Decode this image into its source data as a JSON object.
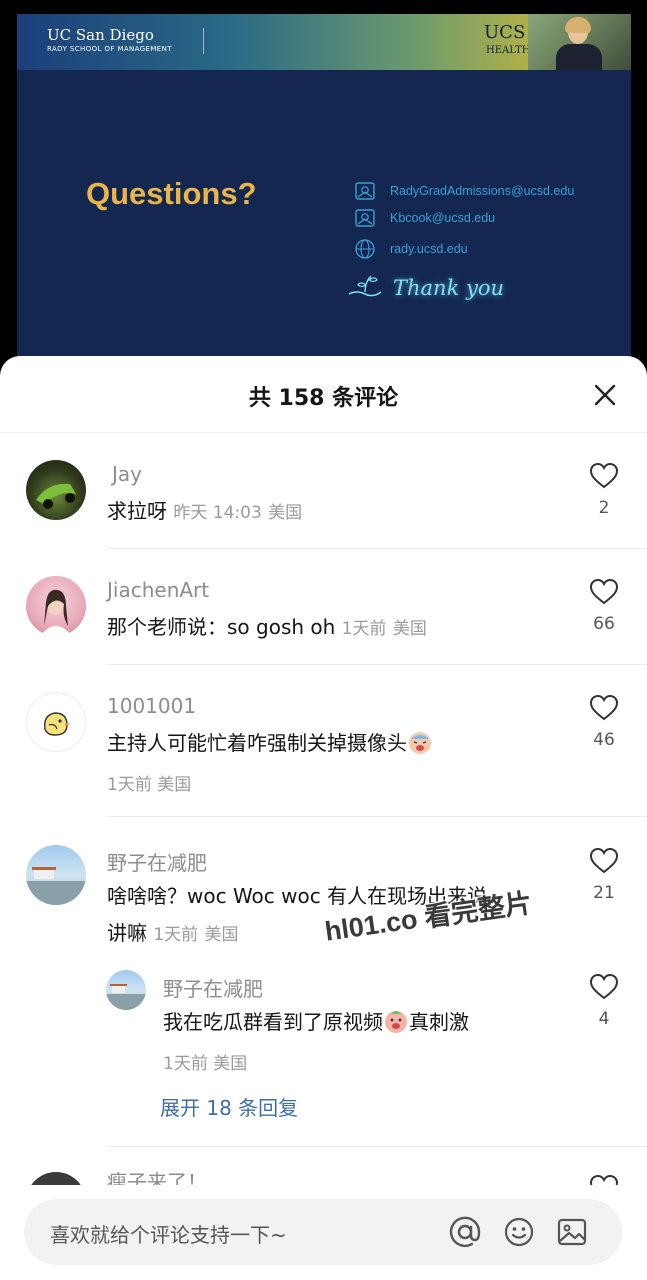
{
  "video": {
    "slide": {
      "ucsd_logo": "UC San Diego",
      "school": "RADY SCHOOL OF MANAGEMENT",
      "ucs_logo": "UCS",
      "health": "HEALTH",
      "title": "Questions?",
      "contacts": [
        {
          "icon": "email-icon",
          "text": "RadyGradAdmissions@ucsd.edu"
        },
        {
          "icon": "email-icon",
          "text": "Kbcook@ucsd.edu"
        },
        {
          "icon": "globe-icon",
          "text": "rady.ucsd.edu"
        }
      ],
      "thank_you": "Thank you"
    }
  },
  "sheet": {
    "title": "共 158 条评论",
    "comments": [
      {
        "username": "Jay",
        "text": "求拉呀",
        "time": "昨天 14:03",
        "location": "美国",
        "likes": "2"
      },
      {
        "username": "JiachenArt",
        "text": "那个老师说：so gosh oh",
        "time": "1天前",
        "location": "美国",
        "likes": "66"
      },
      {
        "username": "1001001",
        "text": "主持人可能忙着咋强制关掉摄像头",
        "time": "1天前",
        "location": "美国",
        "likes": "46"
      },
      {
        "username": "野子在减肥",
        "text_line1": "啥啥啥？woc Woc woc 有人在现场出来说",
        "text_line2": "讲嘛",
        "time": "1天前",
        "location": "美国",
        "likes": "21"
      }
    ],
    "reply": {
      "username": "野子在减肥",
      "text_before": "我在吃瓜群看到了原视频",
      "text_after": "真刺激",
      "time": "1天前",
      "location": "美国",
      "likes": "4"
    },
    "expand_replies": "展开 18 条回复",
    "next_comment_user": "瘦子来了！"
  },
  "watermark": "hl01.co 看完整片",
  "input_bar": {
    "placeholder": "喜欢就给个评论支持一下~"
  }
}
